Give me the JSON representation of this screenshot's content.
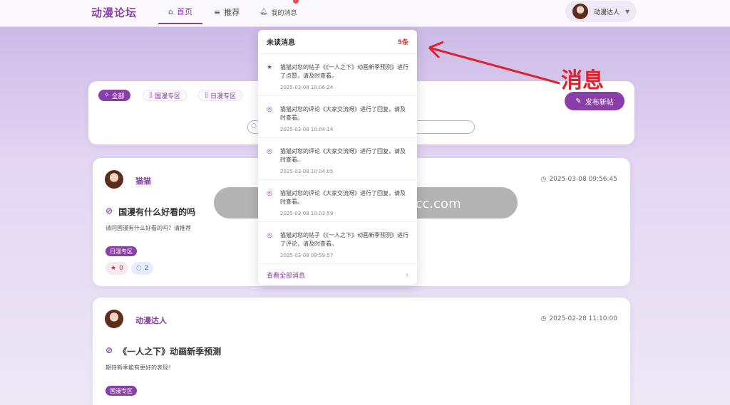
{
  "header": {
    "logo": "动漫论坛",
    "nav": [
      {
        "label": "首页",
        "icon": "home-icon"
      },
      {
        "label": "推荐",
        "icon": "stack-icon"
      },
      {
        "label": "我的消息",
        "icon": "bell-icon"
      }
    ],
    "user_name": "动漫达人"
  },
  "filter": {
    "chips": [
      {
        "label": "全部",
        "icon": "magic-icon"
      },
      {
        "label": "国漫专区",
        "icon": "bookmark-icon"
      },
      {
        "label": "日漫专区",
        "icon": "bookmark-icon"
      }
    ],
    "new_post_label": "发布新帖",
    "search_placeholder": ""
  },
  "posts": [
    {
      "author": "猫猫",
      "time": "2025-03-08 09:56:45",
      "title": "国漫有什么好看的吗",
      "desc": "请问国漫有什么好看的吗？请推荐",
      "tag": "日漫专区",
      "likes": "0",
      "comments": "2"
    },
    {
      "author": "动漫达人",
      "time": "2025-02-28 11:10:00",
      "title": "《一人之下》动画新季预测",
      "desc": "期待新季能有更好的表现！",
      "tag": "国漫专区"
    }
  ],
  "toast": "猫头鹰源码 maotouyingcc.com",
  "notifications": {
    "title": "未读消息",
    "count": "5条",
    "items": [
      {
        "icon": "star-icon",
        "text": "猫猫对您的帖子《《一人之下》动画新季预测》进行了点赞，请及时查看。",
        "time": "2025-03-08 10:06:24"
      },
      {
        "icon": "comment-icon",
        "text": "猫猫对您的评论《大家交流呀》进行了回复，请及时查看。",
        "time": "2025-03-08 10:04:14"
      },
      {
        "icon": "comment-icon",
        "text": "猫猫对您的评论《大家交流呀》进行了回复，请及时查看。",
        "time": "2025-03-08 10:04:05"
      },
      {
        "icon": "comment-icon",
        "text": "猫猫对您的评论《大家交流呀》进行了回复，请及时查看。",
        "time": "2025-03-08 10:03:59"
      },
      {
        "icon": "comment-icon",
        "text": "猫猫对您的帖子《《一人之下》动画新季预测》进行了评论，请及时查看。",
        "time": "2025-03-08 09:59:57"
      }
    ],
    "view_all": "查看全部消息"
  },
  "annotation": "消息",
  "colors": {
    "accent": "#8a3ea8",
    "annotation": "#e0202a"
  }
}
